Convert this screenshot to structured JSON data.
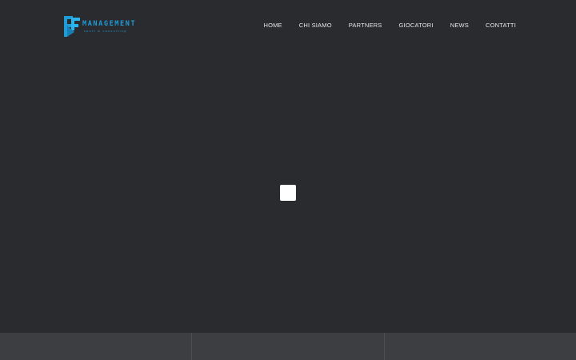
{
  "header": {
    "logo": {
      "wordmark": "MANAGEMENT",
      "tagline": "sport & consulting",
      "color": "#1f9bd8",
      "icon": "logo-mark-icon"
    },
    "nav": [
      {
        "label": "HOME"
      },
      {
        "label": "CHI SIAMO"
      },
      {
        "label": "PARTNERS"
      },
      {
        "label": "GIOCATORI"
      },
      {
        "label": "NEWS"
      },
      {
        "label": "CONTATTI"
      }
    ]
  },
  "colors": {
    "background": "#2a2b2f",
    "accent": "#1f9bd8",
    "nav_text": "#e6e6e6",
    "loader": "#ffffff",
    "panel": "#3d3e42"
  },
  "loader": {
    "icon": "loading-square-icon"
  },
  "bottom_panels": [
    "",
    "",
    ""
  ]
}
